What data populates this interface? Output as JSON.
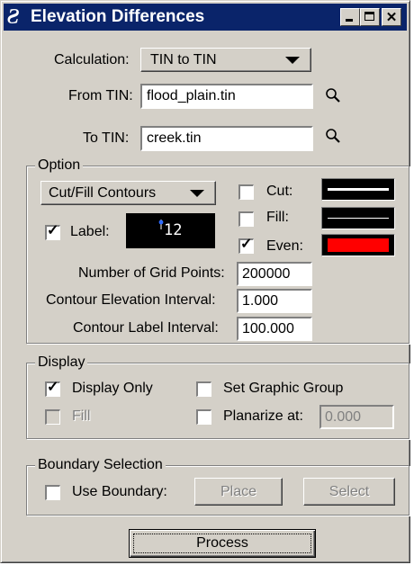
{
  "window": {
    "title": "Elevation Differences",
    "app_icon": "microstation-icon"
  },
  "calculation": {
    "label": "Calculation:",
    "value": "TIN to TIN"
  },
  "from_tin": {
    "label": "From TIN:",
    "value": "flood_plain.tin"
  },
  "to_tin": {
    "label": "To TIN:",
    "value": "creek.tin"
  },
  "option": {
    "title": "Option",
    "mode_value": "Cut/Fill Contours",
    "label_checkbox": {
      "label": "Label:",
      "checked": true
    },
    "label_text_sample": "12",
    "cut": {
      "label": "Cut:",
      "checked": false
    },
    "fill": {
      "label": "Fill:",
      "checked": false
    },
    "even": {
      "label": "Even:",
      "checked": true
    },
    "even_color": "#ff0000",
    "grid_points": {
      "label": "Number of Grid Points:",
      "value": "200000"
    },
    "contour_interval": {
      "label": "Contour Elevation Interval:",
      "value": "1.000"
    },
    "label_interval": {
      "label": "Contour Label Interval:",
      "value": "100.000"
    }
  },
  "display": {
    "title": "Display",
    "display_only": {
      "label": "Display Only",
      "checked": true
    },
    "set_graphic_group": {
      "label": "Set Graphic Group",
      "checked": false
    },
    "fill": {
      "label": "Fill",
      "checked": false
    },
    "planarize": {
      "label": "Planarize at:",
      "checked": false,
      "value": "0.000"
    }
  },
  "boundary": {
    "title": "Boundary Selection",
    "use_boundary": {
      "label": "Use Boundary:",
      "checked": false
    },
    "place_label": "Place",
    "select_label": "Select"
  },
  "process_label": "Process"
}
